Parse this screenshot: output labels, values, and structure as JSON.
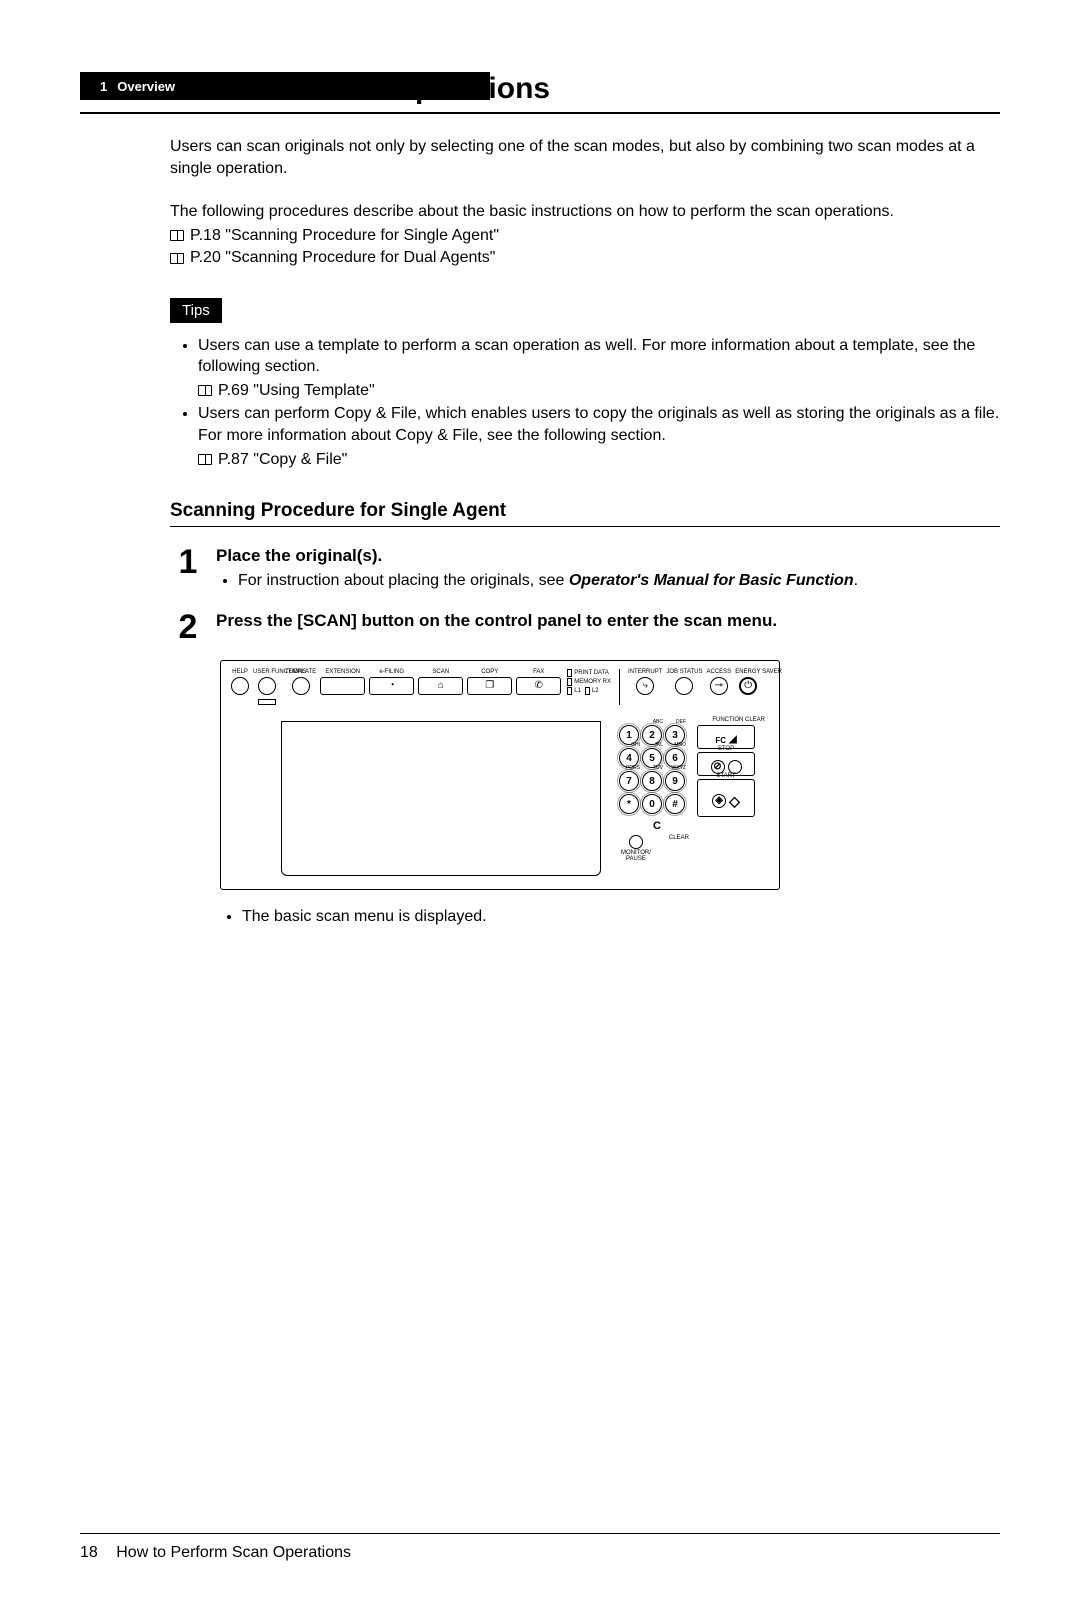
{
  "header": {
    "chapter_num": "1",
    "chapter_title": "Overview"
  },
  "title": "How to Perform Scan Operations",
  "intro_p1": "Users can scan originals not only by selecting one of the scan modes, but also by combining two scan modes at a single operation.",
  "intro_p2": "The following procedures describe about the basic instructions on how to perform the scan operations.",
  "refs": [
    "P.18 \"Scanning Procedure for Single Agent\"",
    "P.20 \"Scanning Procedure for Dual Agents\""
  ],
  "tips": {
    "label": "Tips",
    "items": [
      {
        "text": "Users can use a template to perform a scan operation as well.  For more information about a template, see the following section.",
        "ref": "P.69 \"Using Template\""
      },
      {
        "text": "Users can perform Copy & File, which enables users to copy the originals as well as storing the originals as a file.  For more information about Copy & File, see the following section.",
        "ref": "P.87 \"Copy & File\""
      }
    ]
  },
  "subheading": "Scanning Procedure for Single Agent",
  "steps": [
    {
      "num": "1",
      "title": "Place the original(s).",
      "bullet_pre": "For instruction about placing the originals, see ",
      "bullet_em": "Operator's Manual for Basic Function",
      "bullet_post": "."
    },
    {
      "num": "2",
      "title": "Press the [SCAN] button on the control panel to enter the scan menu."
    }
  ],
  "panel": {
    "top_buttons": [
      "HELP",
      "USER FUNCTIONS",
      "TEMPLATE",
      "EXTENSION",
      "e-FILING",
      "SCAN",
      "COPY",
      "FAX"
    ],
    "leds": [
      "PRINT DATA",
      "MEMORY RX",
      "L1",
      "L2"
    ],
    "right_buttons": [
      "INTERRUPT",
      "JOB STATUS",
      "ACCESS",
      "ENERGY SAVER"
    ],
    "function_clear": "FUNCTION CLEAR",
    "fc": "FC",
    "stop": "STOP",
    "start": "START",
    "clear": "CLEAR",
    "monitor": "MONITOR/\nPAUSE",
    "keypad": [
      {
        "d": "1",
        "s": ""
      },
      {
        "d": "2",
        "s": "ABC"
      },
      {
        "d": "3",
        "s": "DEF"
      },
      {
        "d": "4",
        "s": "GHI"
      },
      {
        "d": "5",
        "s": "JKL"
      },
      {
        "d": "6",
        "s": "MNO"
      },
      {
        "d": "7",
        "s": "PQRS"
      },
      {
        "d": "8",
        "s": "TUV"
      },
      {
        "d": "9",
        "s": "WXYZ"
      },
      {
        "d": "*",
        "s": ""
      },
      {
        "d": "0",
        "s": ""
      },
      {
        "d": "#",
        "s": ""
      }
    ],
    "c_key": "C"
  },
  "post_step_bullet": "The basic scan menu is displayed.",
  "footer": {
    "page": "18",
    "title": "How to Perform Scan Operations"
  }
}
